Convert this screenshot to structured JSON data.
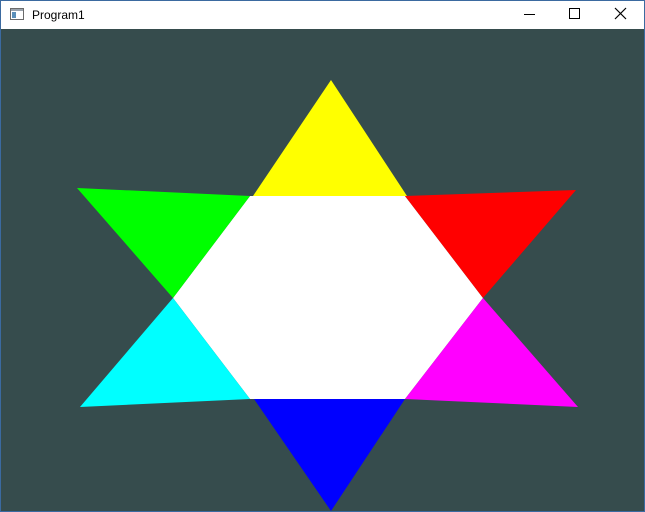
{
  "window": {
    "title": "Program1",
    "background_color": "#364c4d",
    "icons": {
      "app": "application-icon",
      "minimize": "minimize-icon",
      "maximize": "maximize-icon",
      "close": "close-icon"
    }
  },
  "scene": {
    "center_color": "#ffffff",
    "triangle_colors": {
      "top": "#ffff00",
      "upper_right": "#ff0000",
      "lower_right": "#ff00ff",
      "bottom": "#0000ff",
      "lower_left": "#00ffff",
      "upper_left": "#00ff00"
    }
  }
}
